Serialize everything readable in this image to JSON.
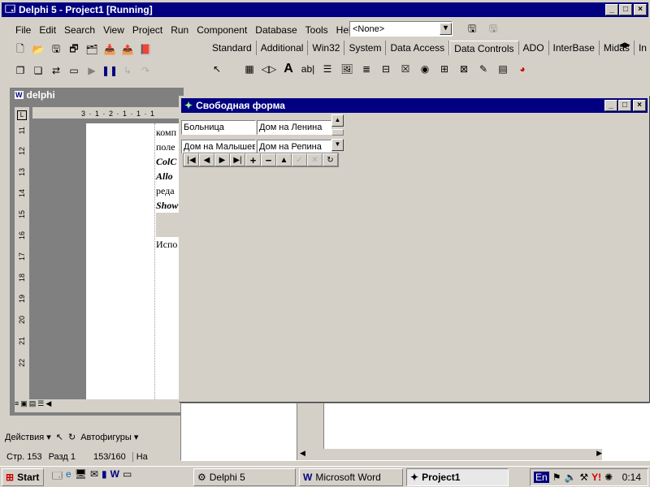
{
  "delphi": {
    "title": "Delphi 5 - Project1 [Running]",
    "menu": [
      "File",
      "Edit",
      "Search",
      "View",
      "Project",
      "Run",
      "Component",
      "Database",
      "Tools",
      "Help"
    ],
    "combo_value": "<None>",
    "palette_tabs": [
      "Standard",
      "Additional",
      "Win32",
      "System",
      "Data Access",
      "Data Controls",
      "ADO",
      "InterBase",
      "Midas",
      "In"
    ],
    "active_tab": "Data Controls"
  },
  "word": {
    "title": "delphi",
    "doc_lines": [
      "комп",
      "поле",
      "ColC",
      "Allo",
      "реда",
      "Show",
      "Испо"
    ],
    "ruler_left": [
      "11",
      "12",
      "13",
      "14",
      "15",
      "16",
      "17",
      "18",
      "19",
      "20",
      "21",
      "22"
    ],
    "ruler_top": "3 · 1 · 2 · 1 · 1 · 1",
    "drawing_toolbar": {
      "actions": "Действия",
      "autoshapes": "Автофигуры"
    },
    "status": {
      "page": "Стр. 153",
      "section": "Разд 1",
      "pages": "153/160",
      "at": "На"
    }
  },
  "form": {
    "title": "Свободная форма",
    "row1": {
      "col1": "Больница",
      "col2": "Дом на Ленина"
    },
    "row2": {
      "col1": "Дом на Малышев",
      "col2": "Дом на Репина"
    }
  },
  "taskbar": {
    "start": "Start",
    "tasks": [
      "Delphi 5",
      "Microsoft Word",
      "Project1"
    ],
    "active_task": "Project1",
    "lang": "En",
    "time": "0:14"
  }
}
